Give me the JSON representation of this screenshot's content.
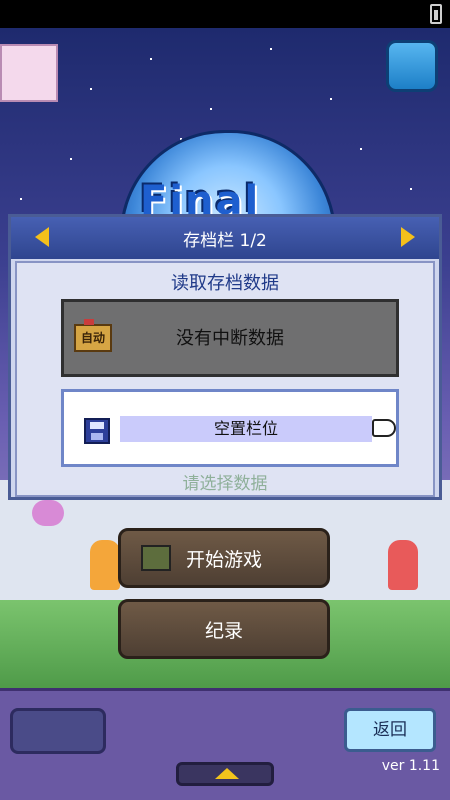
{
  "dialog": {
    "header_title": "存档栏 1/2",
    "load_title": "读取存档数据",
    "no_suspend_label": "没有中断数据",
    "auto_label": "自动",
    "empty_slot_label": "空置栏位",
    "select_hint": "请选择数据"
  },
  "menu": {
    "start_label": "开始游戏",
    "records_label": "纪录"
  },
  "bottom": {
    "back_label": "返回",
    "version": "ver 1.11"
  },
  "icons": {
    "avatar": "avatar-portrait",
    "language": "language-switch-icon",
    "auto_save": "auto-save-icon",
    "floppy": "floppy-disk-icon",
    "hand": "pointing-hand-icon",
    "robot": "robot-icon",
    "up": "up-arrow-icon"
  },
  "colors": {
    "header_bg": "#2f458f",
    "arrow": "#f4c01b",
    "hint_text": "#8fb09a",
    "back_btn": "#b4e6ff"
  }
}
